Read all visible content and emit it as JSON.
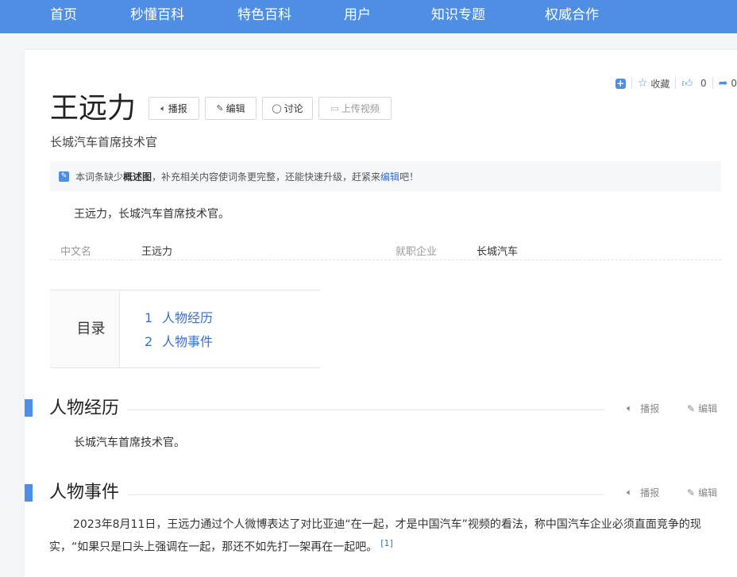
{
  "nav": {
    "items": [
      {
        "label": "首页"
      },
      {
        "label": "秒懂百科"
      },
      {
        "label": "特色百科"
      },
      {
        "label": "用户"
      },
      {
        "label": "知识专题"
      },
      {
        "label": "权威合作"
      }
    ]
  },
  "toolbar": {
    "favorite_label": "收藏",
    "like_count": "0",
    "share_count": "0"
  },
  "entry": {
    "title": "王远力",
    "subtitle": "长城汽车首席技术官",
    "buttons": {
      "read": "播报",
      "edit": "编辑",
      "discuss": "讨论",
      "upload_video": "上传视频"
    },
    "notice": {
      "pre": "本词条缺少",
      "bold": "概述图",
      "mid": "，补充相关内容使词条更完整，还能快速升级，赶紧来",
      "link": "编辑",
      "post": "吧！"
    },
    "summary": "王远力，长城汽车首席技术官。",
    "info": [
      {
        "label": "中文名",
        "value": "王远力"
      },
      {
        "label": "就职企业",
        "value": "长城汽车"
      }
    ]
  },
  "toc": {
    "label": "目录",
    "items": [
      {
        "num": "1",
        "label": "人物经历"
      },
      {
        "num": "2",
        "label": "人物事件"
      }
    ]
  },
  "sections": [
    {
      "title": "人物经历",
      "read_label": "播报",
      "edit_label": "编辑",
      "body": "长城汽车首席技术官。"
    },
    {
      "title": "人物事件",
      "read_label": "播报",
      "edit_label": "编辑",
      "body": "2023年8月11日，王远力通过个人微博表达了对比亚迪“在一起，才是中国汽车”视频的看法，称中国汽车企业必须直面竞争的现实，“如果只是口头上强调在一起，那还不如先打一架再在一起吧。",
      "ref": "[1]"
    }
  ],
  "colors": {
    "accent": "#4e8fe5",
    "link": "#3a6fd1"
  }
}
